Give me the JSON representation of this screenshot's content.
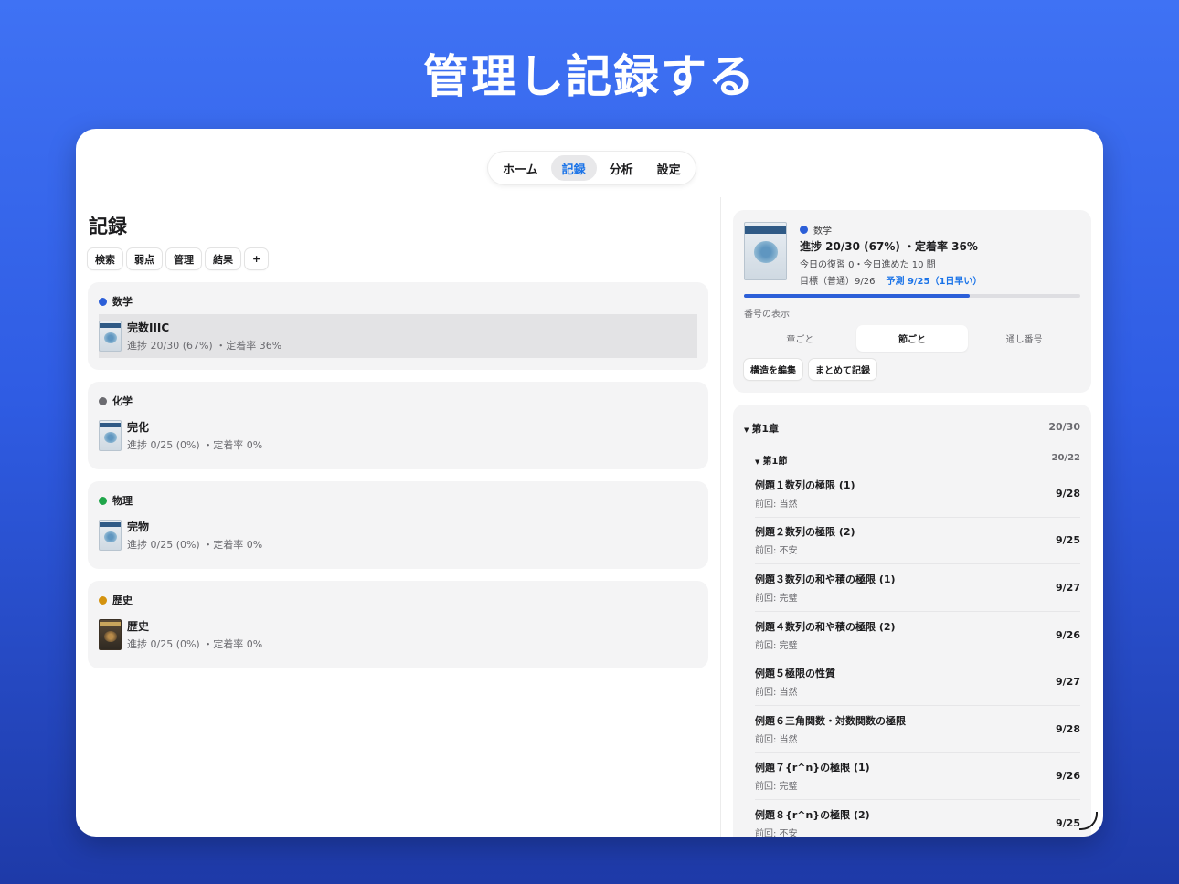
{
  "hero": {
    "title": "管理し記録する"
  },
  "nav": {
    "tabs": [
      "ホーム",
      "記録",
      "分析",
      "設定"
    ],
    "active": "記録"
  },
  "left": {
    "title": "記録",
    "chips": [
      "検索",
      "弱点",
      "管理",
      "結果",
      "+"
    ],
    "subjects": [
      {
        "name": "数学",
        "color": "#2c5fd8",
        "book": "完数IIIC",
        "stats": "進捗 20/30 (67%) ・定着率 36%",
        "selected": true
      },
      {
        "name": "化学",
        "color": "#6b6b70",
        "book": "完化",
        "stats": "進捗 0/25 (0%) ・定着率 0%",
        "selected": false
      },
      {
        "name": "物理",
        "color": "#20a64a",
        "book": "完物",
        "stats": "進捗 0/25 (0%) ・定着率 0%",
        "selected": false
      },
      {
        "name": "歴史",
        "color": "#d4930f",
        "book": "歴史",
        "stats": "進捗 0/25 (0%) ・定着率 0%",
        "selected": false
      }
    ]
  },
  "summary": {
    "subject": "数学",
    "subject_color": "#2c5fd8",
    "progress": "進捗 20/30 (67%) ・定着率 36%",
    "today": "今日の復習 0・今日進めた 10 問",
    "goal": "目標（普通）9/26",
    "prediction": "予測 9/25（1日早い）",
    "progress_fraction": 0.67,
    "numbering_label": "番号の表示",
    "numbering_options": [
      "章ごと",
      "節ごと",
      "通し番号"
    ],
    "numbering_active": "節ごと",
    "buttons": [
      "構造を編集",
      "まとめて記録"
    ]
  },
  "list": {
    "chapter": {
      "label": "第1章",
      "count": "20/30"
    },
    "section": {
      "label": "第1節",
      "count": "20/22"
    },
    "problems": [
      {
        "title": "例題１数列の極限 (1)",
        "prev": "前回: 当然",
        "date": "9/28"
      },
      {
        "title": "例題２数列の極限 (2)",
        "prev": "前回: 不安",
        "date": "9/25"
      },
      {
        "title": "例題３数列の和や積の極限 (1)",
        "prev": "前回: 完璧",
        "date": "9/27"
      },
      {
        "title": "例題４数列の和や積の極限 (2)",
        "prev": "前回: 完璧",
        "date": "9/26"
      },
      {
        "title": "例題５極限の性質",
        "prev": "前回: 当然",
        "date": "9/27"
      },
      {
        "title": "例題６三角関数・対数関数の極限",
        "prev": "前回: 当然",
        "date": "9/28"
      },
      {
        "title": "例題７{r^n}の極限 (1)",
        "prev": "前回: 完璧",
        "date": "9/26"
      },
      {
        "title": "例題８{r^n}の極限 (2)",
        "prev": "前回: 不安",
        "date": "9/25"
      }
    ]
  }
}
